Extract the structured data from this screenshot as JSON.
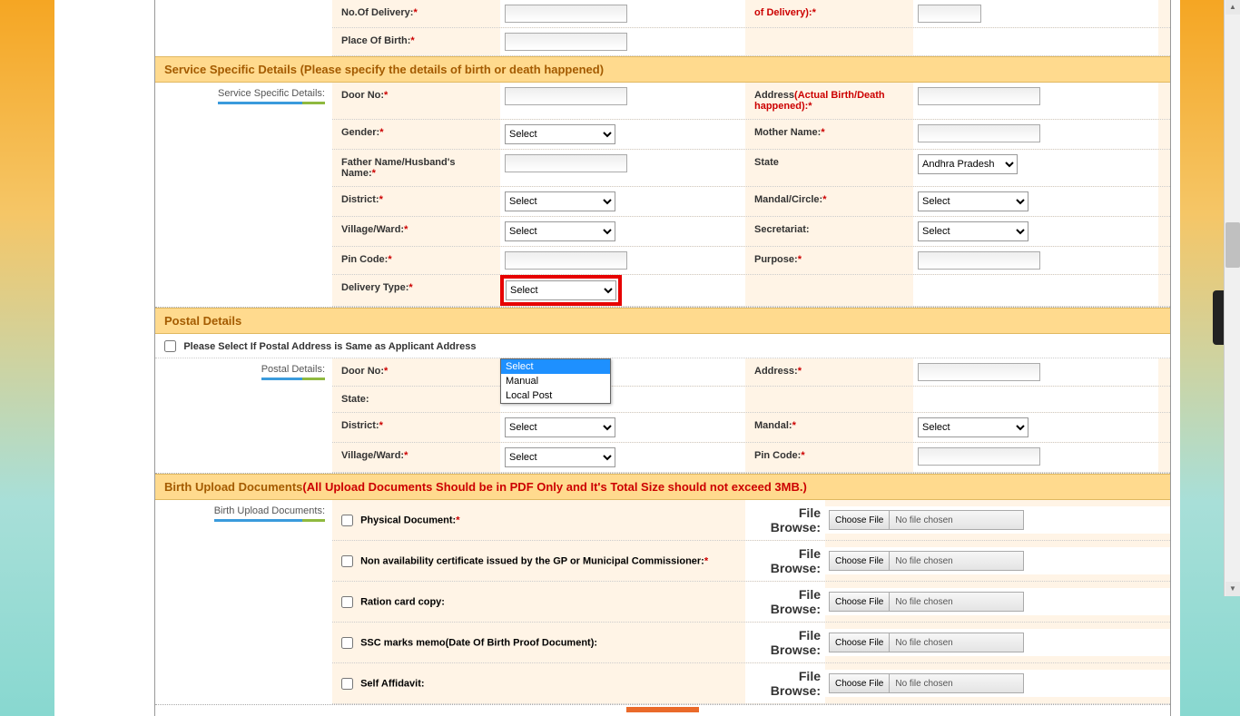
{
  "top": {
    "no_of_delivery_label": "No.Of Delivery:",
    "of_delivery_label": "of Delivery):",
    "place_of_birth_label": "Place Of Birth:"
  },
  "section1": {
    "header": "Service Specific Details (Please specify the details of birth or death happened)",
    "sidelabel": "Service Specific Details:",
    "door_no": "Door No:",
    "address_birth": "Address",
    "address_birth_red": "(Actual Birth/Death happened):",
    "gender": "Gender:",
    "mother_name": "Mother Name:",
    "father_name": "Father Name/Husband's Name:",
    "state": "State",
    "state_value": "Andhra Pradesh",
    "district": "District:",
    "mandal_circle": "Mandal/Circle:",
    "village_ward": "Village/Ward:",
    "secretariat": "Secretariat:",
    "pin_code": "Pin Code:",
    "purpose": "Purpose:",
    "delivery_type": "Delivery Type:",
    "select": "Select",
    "dropdown_options": [
      "Select",
      "Manual",
      "Local Post"
    ]
  },
  "section2": {
    "header": "Postal Details",
    "checkbox_label": "Please Select If Postal Address is Same as Applicant Address",
    "sidelabel": "Postal Details:",
    "door_no": "Door No:",
    "address": "Address:",
    "state": "State:",
    "district": "District:",
    "mandal": "Mandal:",
    "village_ward": "Village/Ward:",
    "pin_code": "Pin Code:",
    "select": "Select"
  },
  "section3": {
    "header_main": "Birth Upload Documents",
    "header_note": "(All Upload Documents Should be in PDF Only and It's Total Size should not exceed 3MB.)",
    "sidelabel": "Birth Upload Documents:",
    "file_browse": "File Browse:",
    "choose_file": "Choose File",
    "no_file": "No file chosen",
    "docs": [
      {
        "label": "Physical Document:",
        "req": true
      },
      {
        "label": "Non availability certificate issued by the GP or Municipal Commissioner:",
        "req": true
      },
      {
        "label": "Ration card copy:",
        "req": false
      },
      {
        "label": "SSC marks memo(Date Of Birth Proof Document):",
        "req": false
      },
      {
        "label": "Self Affidavit:",
        "req": false
      }
    ]
  }
}
